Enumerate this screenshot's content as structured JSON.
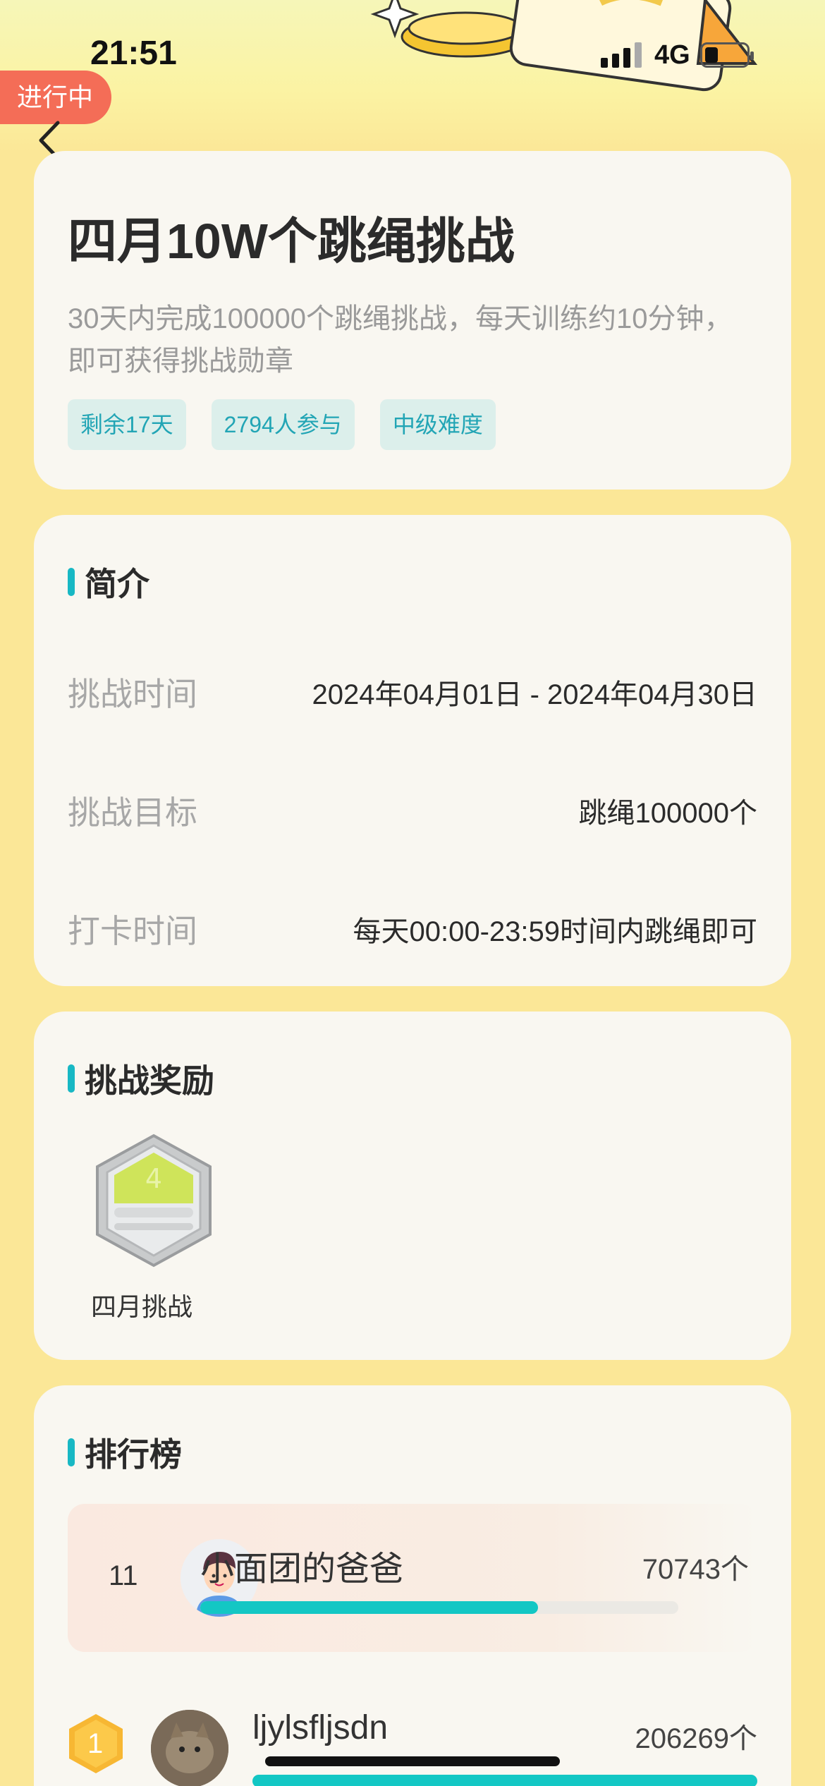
{
  "status_bar": {
    "time": "21:51",
    "network": "4G"
  },
  "challenge": {
    "status": "进行中",
    "title": "四月10W个跳绳挑战",
    "description": "30天内完成100000个跳绳挑战，每天训练约10分钟，即可获得挑战勋章",
    "tags": [
      "剩余17天",
      "2794人参与",
      "中级难度"
    ]
  },
  "intro": {
    "heading": "简介",
    "rows": [
      {
        "label": "挑战时间",
        "value": "2024年04月01日 - 2024年04月30日"
      },
      {
        "label": "挑战目标",
        "value": "跳绳100000个"
      },
      {
        "label": "打卡时间",
        "value": "每天00:00-23:59时间内跳绳即可"
      }
    ]
  },
  "rewards": {
    "heading": "挑战奖励",
    "medal_name": "四月挑战",
    "medal_icon": "april-challenge-badge"
  },
  "leaderboard": {
    "heading": "排行榜",
    "goal": 100000,
    "me": {
      "rank": "11",
      "name": "小面团的爸爸",
      "count": "70743个",
      "progress": 0.707
    },
    "entries": [
      {
        "rank": "1",
        "name": "ljylsfljsdn",
        "count": "206269个",
        "progress": 1.0
      }
    ]
  },
  "colors": {
    "accent": "#18b8c4",
    "progress": "#13c7c4",
    "status_pill": "#f46d57",
    "background": "#fbe797"
  }
}
